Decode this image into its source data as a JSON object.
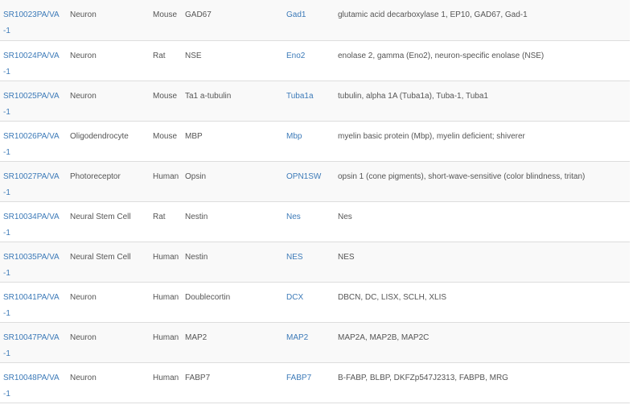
{
  "colors": {
    "link": "#3c7ab8",
    "text": "#555555",
    "stripe": "#f9f9f9",
    "border": "#dddddd"
  },
  "rows": [
    {
      "catalog": "SR10023PA/VA-1",
      "cell_type": "Neuron",
      "species": "Mouse",
      "marker": "GAD67",
      "gene": "Gad1",
      "aliases": "glutamic acid decarboxylase 1, EP10, GAD67, Gad-1"
    },
    {
      "catalog": "SR10024PA/VA-1",
      "cell_type": "Neuron",
      "species": "Rat",
      "marker": "NSE",
      "gene": "Eno2",
      "aliases": "enolase 2, gamma (Eno2), neuron-specific enolase (NSE)"
    },
    {
      "catalog": "SR10025PA/VA-1",
      "cell_type": "Neuron",
      "species": "Mouse",
      "marker": "Ta1 a-tubulin",
      "gene": "Tuba1a",
      "aliases": "tubulin, alpha 1A (Tuba1a), Tuba-1, Tuba1"
    },
    {
      "catalog": "SR10026PA/VA-1",
      "cell_type": "Oligodendrocyte",
      "species": "Mouse",
      "marker": "MBP",
      "gene": "Mbp",
      "aliases": "myelin basic protein (Mbp), myelin deficient; shiverer"
    },
    {
      "catalog": "SR10027PA/VA-1",
      "cell_type": "Photoreceptor",
      "species": "Human",
      "marker": "Opsin",
      "gene": "OPN1SW",
      "aliases": "opsin 1 (cone pigments), short-wave-sensitive (color blindness, tritan)"
    },
    {
      "catalog": "SR10034PA/VA-1",
      "cell_type": "Neural Stem Cell",
      "species": "Rat",
      "marker": "Nestin",
      "gene": "Nes",
      "aliases": "Nes"
    },
    {
      "catalog": "SR10035PA/VA-1",
      "cell_type": "Neural Stem Cell",
      "species": "Human",
      "marker": "Nestin",
      "gene": "NES",
      "aliases": "NES"
    },
    {
      "catalog": "SR10041PA/VA-1",
      "cell_type": "Neuron",
      "species": "Human",
      "marker": "Doublecortin",
      "gene": "DCX",
      "aliases": "DBCN, DC, LISX, SCLH, XLIS"
    },
    {
      "catalog": "SR10047PA/VA-1",
      "cell_type": "Neuron",
      "species": "Human",
      "marker": "MAP2",
      "gene": "MAP2",
      "aliases": "MAP2A, MAP2B, MAP2C"
    },
    {
      "catalog": "SR10048PA/VA-1",
      "cell_type": "Neuron",
      "species": "Human",
      "marker": "FABP7",
      "gene": "FABP7",
      "aliases": "B-FABP, BLBP, DKFZp547J2313, FABPB, MRG"
    }
  ]
}
